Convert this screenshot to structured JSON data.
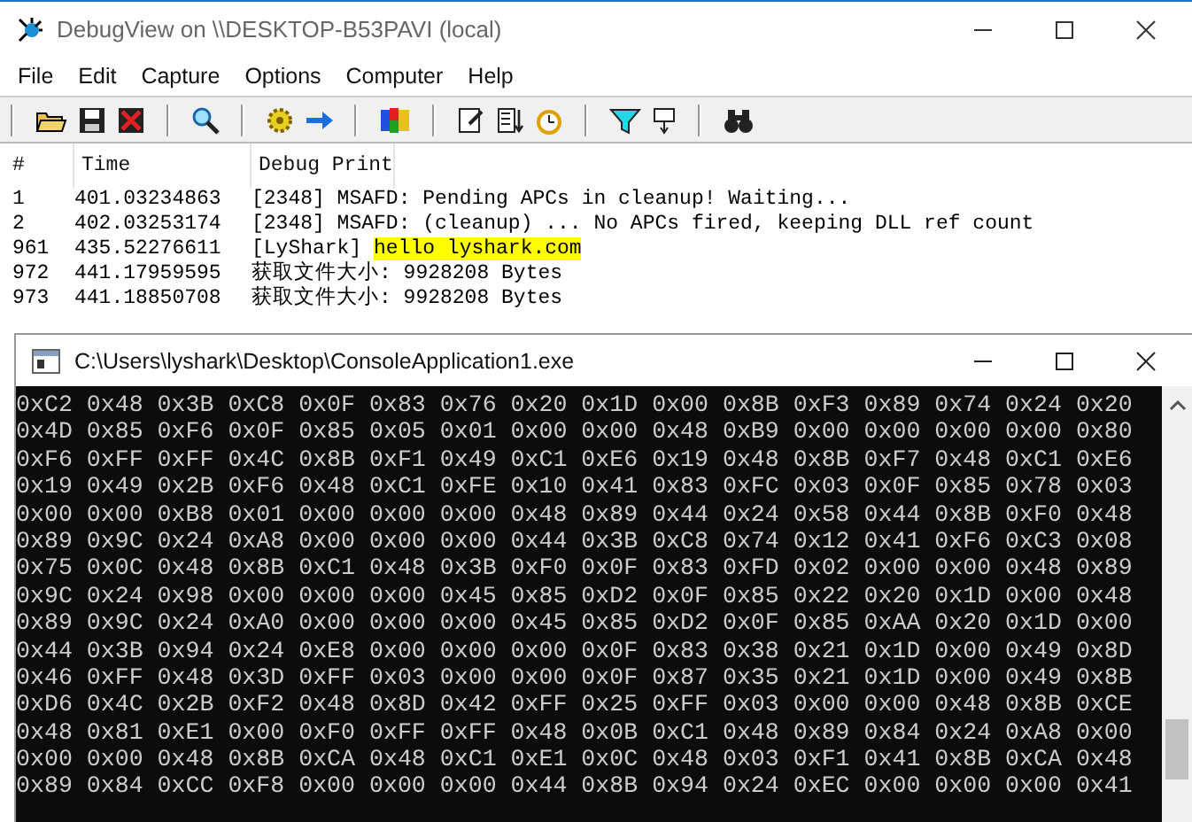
{
  "window": {
    "title": "DebugView on \\\\DESKTOP-B53PAVI (local)"
  },
  "menu": [
    "File",
    "Edit",
    "Capture",
    "Options",
    "Computer",
    "Help"
  ],
  "log": {
    "columns": [
      "#",
      "Time",
      "Debug Print"
    ],
    "rows": [
      {
        "number": "1",
        "time": "401.03234863",
        "print": [
          {
            "text": "[2348] MSAFD: Pending APCs in cleanup! Waiting...",
            "highlighted": false
          }
        ]
      },
      {
        "number": "2",
        "time": "402.03253174",
        "print": [
          {
            "text": "[2348] MSAFD: (cleanup) ... No APCs fired, keeping DLL ref count",
            "highlighted": false
          }
        ]
      },
      {
        "number": "961",
        "time": "435.52276611",
        "print": [
          {
            "text": "[LyShark] ",
            "highlighted": false
          },
          {
            "text": "hello lyshark.com",
            "highlighted": true
          }
        ]
      },
      {
        "number": "972",
        "time": "441.17959595",
        "print": [
          {
            "text": "获取文件大小: 9928208 Bytes",
            "highlighted": false
          }
        ]
      },
      {
        "number": "973",
        "time": "441.18850708",
        "print": [
          {
            "text": "获取文件大小: 9928208 Bytes",
            "highlighted": false
          }
        ]
      }
    ]
  },
  "console": {
    "title": "C:\\Users\\lyshark\\Desktop\\ConsoleApplication1.exe",
    "lines": [
      "0xC2 0x48 0x3B 0xC8 0x0F 0x83 0x76 0x20 0x1D 0x00 0x8B 0xF3 0x89 0x74 0x24 0x20",
      "0x4D 0x85 0xF6 0x0F 0x85 0x05 0x01 0x00 0x00 0x48 0xB9 0x00 0x00 0x00 0x00 0x80",
      "0xF6 0xFF 0xFF 0x4C 0x8B 0xF1 0x49 0xC1 0xE6 0x19 0x48 0x8B 0xF7 0x48 0xC1 0xE6",
      "0x19 0x49 0x2B 0xF6 0x48 0xC1 0xFE 0x10 0x41 0x83 0xFC 0x03 0x0F 0x85 0x78 0x03",
      "0x00 0x00 0xB8 0x01 0x00 0x00 0x00 0x48 0x89 0x44 0x24 0x58 0x44 0x8B 0xF0 0x48",
      "0x89 0x9C 0x24 0xA8 0x00 0x00 0x00 0x44 0x3B 0xC8 0x74 0x12 0x41 0xF6 0xC3 0x08",
      "0x75 0x0C 0x48 0x8B 0xC1 0x48 0x3B 0xF0 0x0F 0x83 0xFD 0x02 0x00 0x00 0x48 0x89",
      "0x9C 0x24 0x98 0x00 0x00 0x00 0x45 0x85 0xD2 0x0F 0x85 0x22 0x20 0x1D 0x00 0x48",
      "0x89 0x9C 0x24 0xA0 0x00 0x00 0x00 0x45 0x85 0xD2 0x0F 0x85 0xAA 0x20 0x1D 0x00",
      "0x44 0x3B 0x94 0x24 0xE8 0x00 0x00 0x00 0x0F 0x83 0x38 0x21 0x1D 0x00 0x49 0x8D",
      "0x46 0xFF 0x48 0x3D 0xFF 0x03 0x00 0x00 0x0F 0x87 0x35 0x21 0x1D 0x00 0x49 0x8B",
      "0xD6 0x4C 0x2B 0xF2 0x48 0x8D 0x42 0xFF 0x25 0xFF 0x03 0x00 0x00 0x48 0x8B 0xCE",
      "0x48 0x81 0xE1 0x00 0xF0 0xFF 0xFF 0x48 0x0B 0xC1 0x48 0x89 0x84 0x24 0xA8 0x00",
      "0x00 0x00 0x48 0x8B 0xCA 0x48 0xC1 0xE1 0x0C 0x48 0x03 0xF1 0x41 0x8B 0xCA 0x48",
      "0x89 0x84 0xCC 0xF8 0x00 0x00 0x00 0x44 0x8B 0x94 0x24 0xEC 0x00 0x00 0x00 0x41"
    ]
  }
}
